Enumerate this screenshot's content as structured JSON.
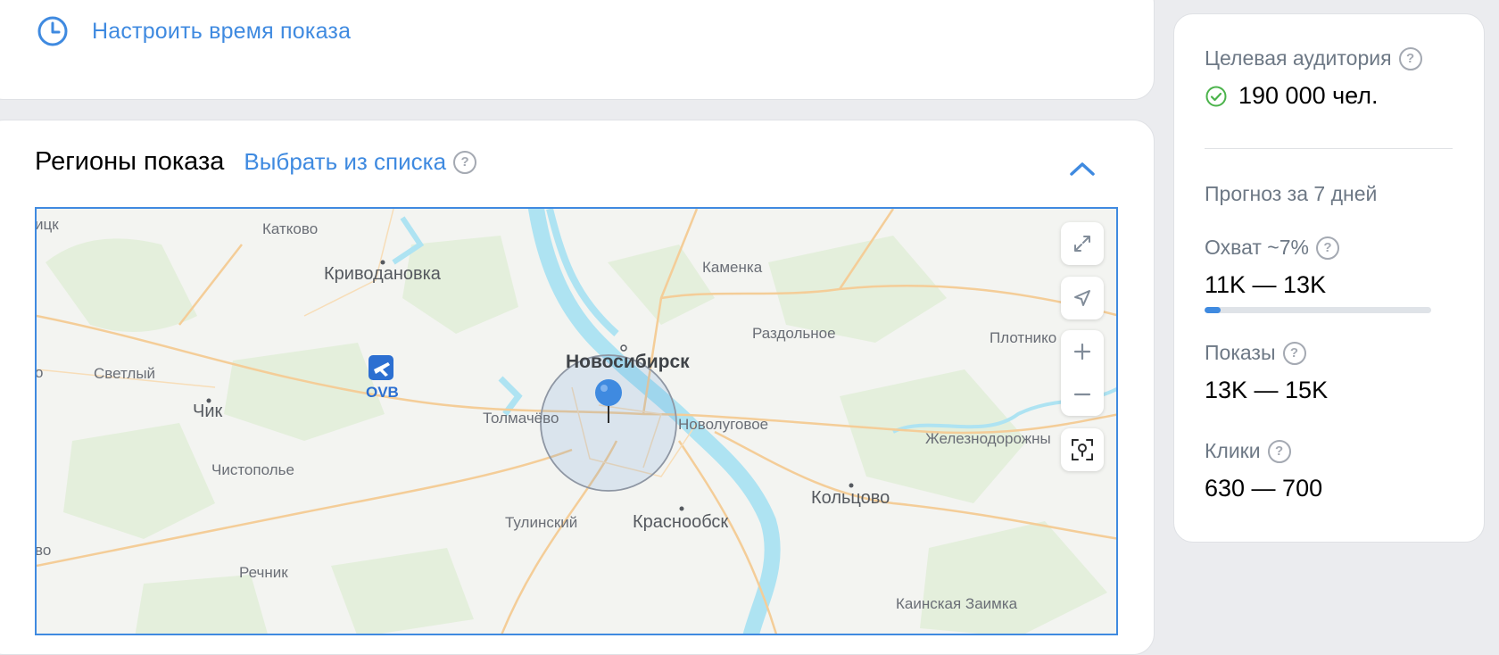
{
  "schedule": {
    "link_label": "Настроить время показа",
    "icon": "clock-icon"
  },
  "regions": {
    "title": "Регионы показа",
    "choose_label": "Выбрать из списка",
    "help_glyph": "?",
    "collapse_icon": "chevron-up-icon"
  },
  "map": {
    "labels": {
      "l1": "ицк",
      "l2": "Катково",
      "l3": "Криводановка",
      "l4": "Каменка",
      "l5": "Раздольное",
      "l6": "Плотнико",
      "l7": "Новосибирск",
      "l8": "о",
      "l9": "Светлый",
      "l10": "Чик",
      "l11": "OVB",
      "l12": "Толмачёво",
      "l13": "Новолуговое",
      "l14": "Железнодорожны",
      "l15": "Чистополье",
      "l16": "Кольцово",
      "l17": "Тулинский",
      "l18": "Краснообск",
      "l19": "во",
      "l20": "Речник",
      "l21": "Каинская Заимка"
    },
    "controls": [
      "expand-icon",
      "navigate-icon",
      "zoom-in-icon",
      "zoom-out-icon",
      "locate-pin-icon"
    ],
    "colors": {
      "water": "#aee3f2",
      "road": "#f4cd98",
      "green": "#e4efdc",
      "radius": "#4a86d8"
    }
  },
  "side": {
    "audience_label": "Целевая аудитория",
    "audience_value": "190 000 чел.",
    "forecast_label": "Прогноз за 7 дней",
    "reach_label": "Охват ~7%",
    "reach_value": "11K — 13K",
    "reach_progress": 0.07,
    "impressions_label": "Показы",
    "impressions_value": "13K — 15K",
    "clicks_label": "Клики",
    "clicks_value": "630 — 700"
  },
  "colors": {
    "accent": "#3f8ae0",
    "success": "#4bb34b",
    "muted": "#6d7885"
  }
}
